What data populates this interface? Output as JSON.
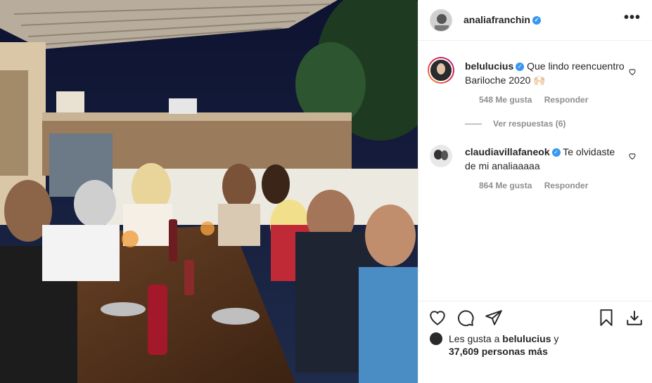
{
  "post": {
    "username": "analiafranchin",
    "verified_mark": "✓",
    "more_label": "•••"
  },
  "comments": [
    {
      "username": "belulucius",
      "text": "Que lindo reencuentro Bariloche 2020 🙌🏻",
      "likes": "548 Me gusta",
      "reply": "Responder",
      "view_replies": "Ver respuestas (6)"
    },
    {
      "username": "claudiavillafaneok",
      "text": "Te olvidaste de mi analiaaaaa",
      "likes": "864 Me gusta",
      "reply": "Responder"
    }
  ],
  "likes_summary": {
    "prefix": "Les gusta a",
    "user": "belulucius",
    "suffix": "y",
    "others": "37,609 personas más"
  },
  "icons": {
    "more": "more-icon",
    "heart": "heart-icon",
    "comment": "comment-icon",
    "share": "share-icon",
    "save": "bookmark-icon",
    "download": "download-icon",
    "verified": "verified-badge-icon"
  },
  "colors": {
    "verified": "#3897f0",
    "meta": "#8e8e8e",
    "text": "#262626",
    "border": "#efefef"
  }
}
